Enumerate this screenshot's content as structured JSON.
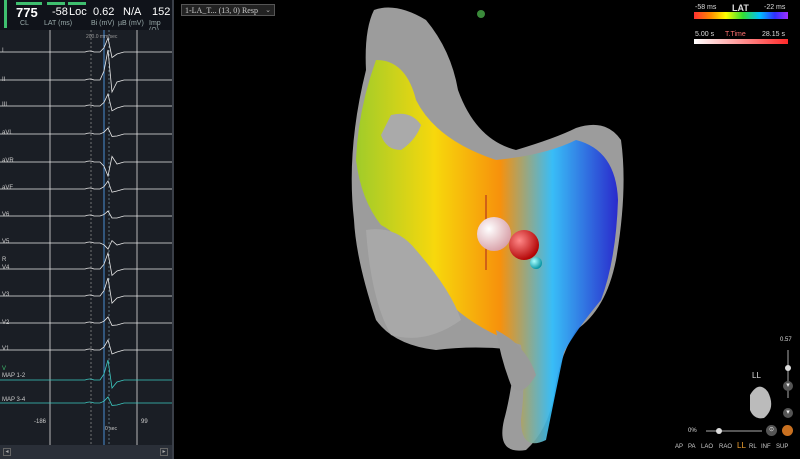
{
  "stats": {
    "cl_value": "775",
    "cl_label": "CL",
    "lat_value": "-58",
    "lat_label": "LAT (ms)",
    "loc_value": "Loc",
    "bi_value": "0.62",
    "bi_label": "Bi (mV)",
    "uni_value": "N/A",
    "uni_label": "µB (mV)",
    "imp_value": "152",
    "imp_label": "Imp (Ω)"
  },
  "traces": {
    "speed_label": "200.0 mm/sec",
    "leads": [
      "I",
      "II",
      "III",
      "aVL",
      "aVR",
      "aVF",
      "V6",
      "V5",
      "V4",
      "V3",
      "V2",
      "V1",
      "MAP 1-2",
      "MAP 3-4"
    ],
    "r_marker": "R",
    "v_marker": "V",
    "window_left": "-186",
    "window_right": "99",
    "time_label": "0 sec"
  },
  "map_selector": {
    "value": "1-LA_T... (13, 0) Resp"
  },
  "legend_lat": {
    "title": "LAT",
    "min": "-58 ms",
    "max": "-22 ms"
  },
  "legend_time": {
    "min": "5.00 s",
    "title": "T.Time",
    "max": "28.15 s"
  },
  "opacity": {
    "value": "0.57"
  },
  "zoom": {
    "value": "0%"
  },
  "orientation": {
    "current": "LL"
  },
  "view_buttons": [
    "AP",
    "PA",
    "LAO",
    "RAO",
    "LL",
    "RL",
    "INF",
    "SUP"
  ],
  "colors": {
    "lat_gradient": [
      "#ff3030",
      "#ff8c00",
      "#ffff00",
      "#33dd33",
      "#00bfff",
      "#3030ff",
      "#a030ff"
    ]
  }
}
